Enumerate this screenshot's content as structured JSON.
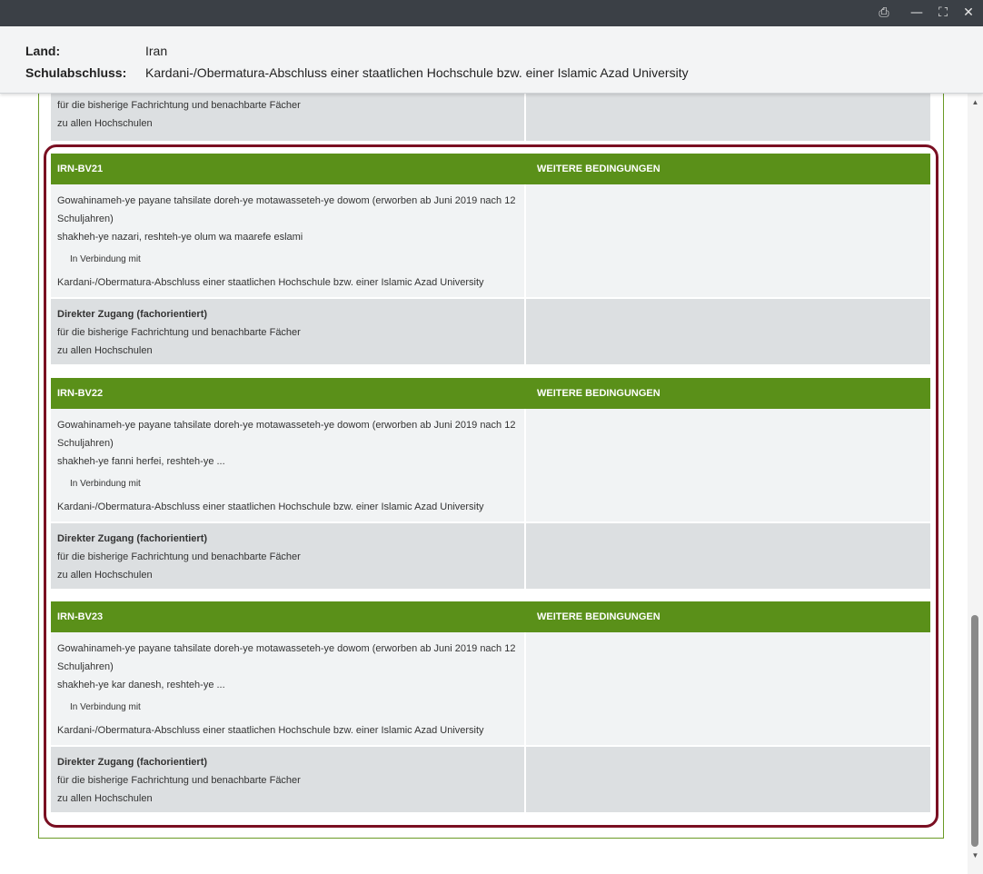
{
  "window": {
    "controls": {
      "print": "⎙",
      "minimize": "—",
      "maximize": "⛶",
      "close": "✕"
    }
  },
  "info": {
    "land_label": "Land:",
    "land_value": "Iran",
    "schulabschluss_label": "Schulabschluss:",
    "schulabschluss_value": "Kardani-/Obermatura-Abschluss einer staatlichen Hochschule bzw. einer Islamic Azad University"
  },
  "partial": {
    "line1": "für die bisherige Fachrichtung und benachbarte Fächer",
    "line2": "zu allen Hochschulen"
  },
  "blocks": [
    {
      "code": "IRN-BV21",
      "cond_header": "WEITERE BEDINGUNGEN",
      "qualification": "Gowahinameh-ye payane tahsilate doreh-ye motawasseteh-ye dowom (erworben ab Juni 2019 nach 12 Schuljahren)",
      "track": "shakheh-ye nazari, reshteh-ye olum wa maarefe eslami",
      "connector": "In Verbindung mit",
      "combined": "Kardani-/Obermatura-Abschluss einer staatlichen Hochschule bzw. einer Islamic Azad University",
      "access_title": "Direkter Zugang (fachorientiert)",
      "access_line1": "für die bisherige Fachrichtung und benachbarte Fächer",
      "access_line2": "zu allen Hochschulen"
    },
    {
      "code": "IRN-BV22",
      "cond_header": "WEITERE BEDINGUNGEN",
      "qualification": "Gowahinameh-ye payane tahsilate doreh-ye motawasseteh-ye dowom (erworben ab Juni 2019 nach 12 Schuljahren)",
      "track": "shakheh-ye fanni herfei, reshteh-ye ...",
      "connector": "In Verbindung mit",
      "combined": "Kardani-/Obermatura-Abschluss einer staatlichen Hochschule bzw. einer Islamic Azad University",
      "access_title": "Direkter Zugang (fachorientiert)",
      "access_line1": "für die bisherige Fachrichtung und benachbarte Fächer",
      "access_line2": "zu allen Hochschulen"
    },
    {
      "code": "IRN-BV23",
      "cond_header": "WEITERE BEDINGUNGEN",
      "qualification": "Gowahinameh-ye payane tahsilate doreh-ye motawasseteh-ye dowom (erworben ab Juni 2019 nach 12 Schuljahren)",
      "track": "shakheh-ye kar danesh, reshteh-ye ...",
      "connector": "In Verbindung mit",
      "combined": "Kardani-/Obermatura-Abschluss einer staatlichen Hochschule bzw. einer Islamic Azad University",
      "access_title": "Direkter Zugang (fachorientiert)",
      "access_line1": "für die bisherige Fachrichtung und benachbarte Fächer",
      "access_line2": "zu allen Hochschulen"
    }
  ],
  "colors": {
    "header_green": "#5a9019",
    "highlight": "#7a0f22",
    "titlebar": "#3b4046"
  }
}
